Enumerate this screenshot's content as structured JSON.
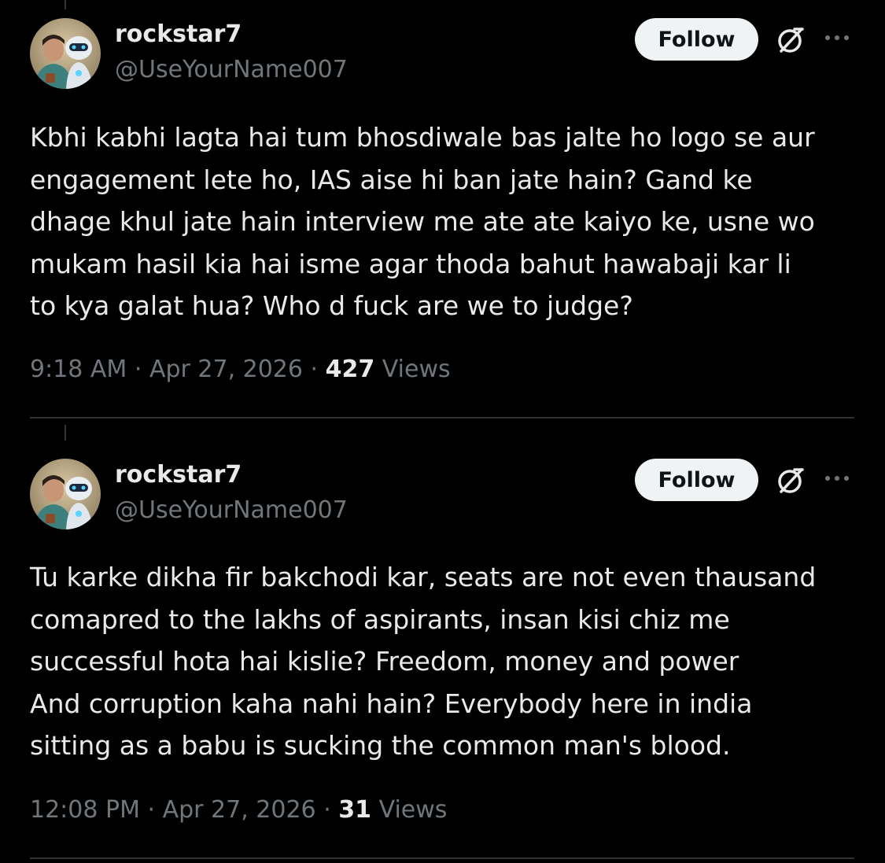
{
  "tweets": [
    {
      "display_name": "rockstar7",
      "handle": "@UseYourName007",
      "follow_label": "Follow",
      "text": "Kbhi kabhi lagta hai tum bhosdiwale bas jalte ho logo se aur\nengagement lete ho, IAS aise hi ban jate hain? Gand ke\ndhage khul jate hain interview me ate ate kaiyo ke, usne wo\nmukam hasil kia hai isme agar thoda bahut hawabaji kar li\nto kya galat hua? Who d fuck are we to judge?",
      "time": "9:18 AM",
      "date": "Apr 27, 2026",
      "separator": "·",
      "views_count": "427",
      "views_label": "Views"
    },
    {
      "display_name": "rockstar7",
      "handle": "@UseYourName007",
      "follow_label": "Follow",
      "text": "Tu karke dikha fir bakchodi kar, seats are not even thausand\ncomapred to the lakhs of aspirants, insan kisi chiz me\nsuccessful hota hai kislie? Freedom, money and power\nAnd corruption kaha nahi hain? Everybody here in india\nsitting as a babu is sucking the common man's blood.",
      "time": "12:08 PM",
      "date": "Apr 27, 2026",
      "separator": "·",
      "views_count": "31",
      "views_label": "Views"
    }
  ],
  "icons": {
    "avatar": "avatar-man-with-robot",
    "grok": "grok-icon",
    "more": "more-horizontal-icon"
  },
  "colors": {
    "background": "#000000",
    "primary_text": "#e7e9ea",
    "secondary_text": "#71767b",
    "follow_bg": "#eff3f4",
    "divider": "#2f3336"
  }
}
